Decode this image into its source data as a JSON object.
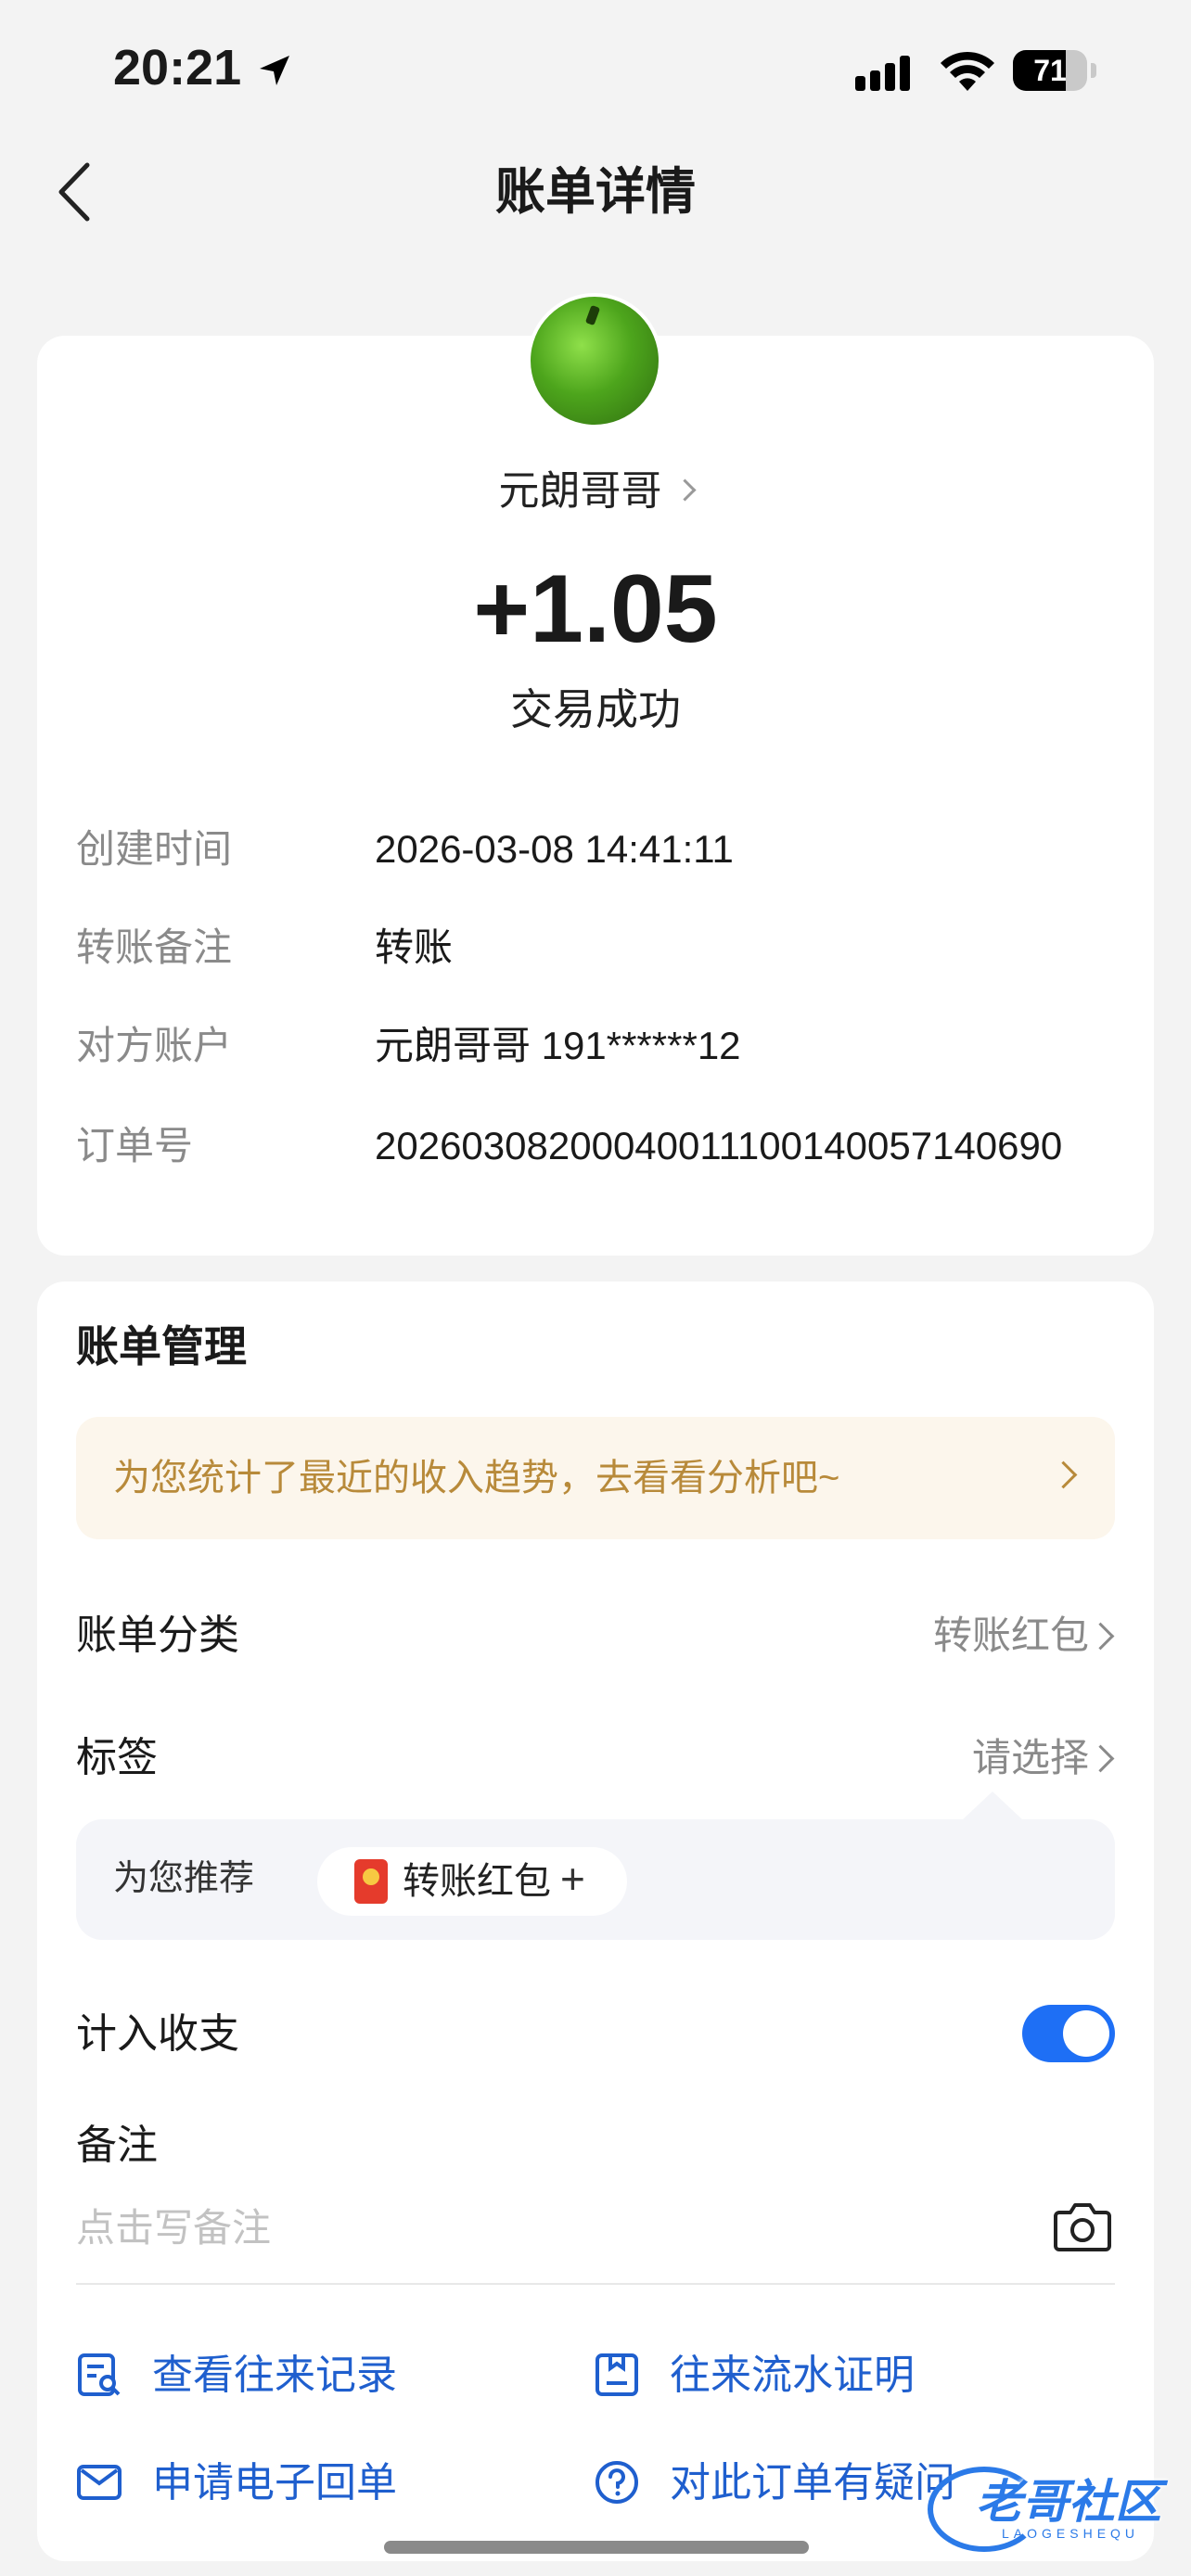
{
  "status_bar": {
    "time": "20:21",
    "battery": "71"
  },
  "nav": {
    "title": "账单详情"
  },
  "summary": {
    "payer_name": "元朗哥哥",
    "amount": "+1.05",
    "status": "交易成功"
  },
  "details": [
    {
      "label": "创建时间",
      "value": "2026-03-08 14:41:11"
    },
    {
      "label": "转账备注",
      "value": "转账"
    },
    {
      "label": "对方账户",
      "value": "元朗哥哥 191******12"
    },
    {
      "label": "订单号",
      "value": "2026030820004001110014005714069​0"
    }
  ],
  "management": {
    "title": "账单管理",
    "banner": "为您统计了最近的收入趋势，去看看分析吧~",
    "category": {
      "label": "账单分类",
      "value": "转账红包"
    },
    "tag": {
      "label": "标签",
      "value": "请选择"
    },
    "recommend": {
      "label": "为您推荐",
      "chip": "转账红包",
      "chip_plus": "+"
    },
    "include": {
      "label": "计入收支",
      "enabled": true
    },
    "note": {
      "label": "备注",
      "placeholder": "点击写备注"
    },
    "actions": [
      {
        "label": "查看往来记录",
        "icon": "record-search-icon"
      },
      {
        "label": "往来流水证明",
        "icon": "statement-icon"
      },
      {
        "label": "申请电子回单",
        "icon": "mail-icon"
      },
      {
        "label": "对此订单有疑问",
        "icon": "question-icon"
      }
    ]
  },
  "watermark": {
    "text": "老哥社区",
    "sub": "LAOGESHEQU"
  },
  "colors": {
    "accent": "#1e6ff5",
    "link": "#1f5fce",
    "banner_text": "#b88a3a"
  }
}
